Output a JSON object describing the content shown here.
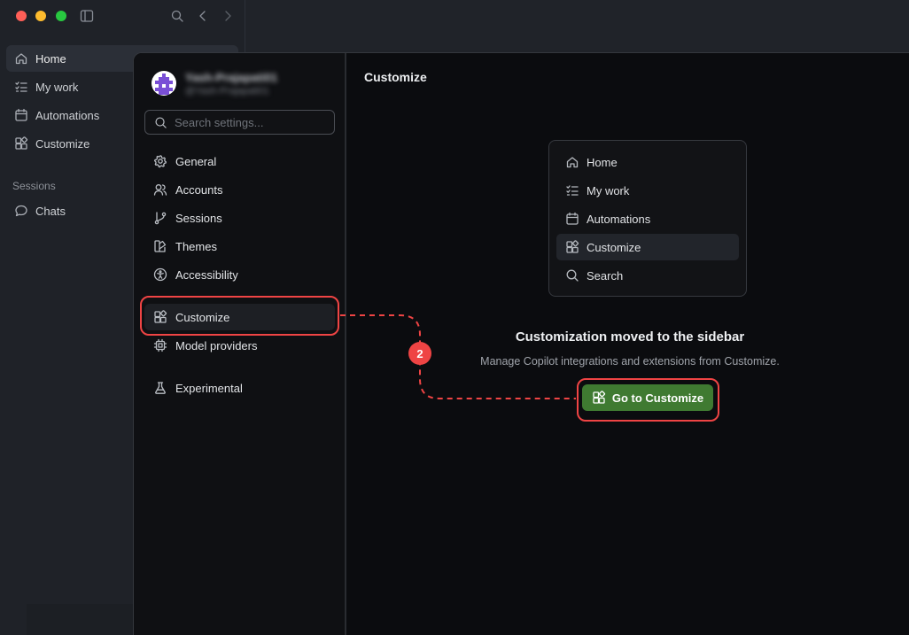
{
  "app": {
    "sidebar": {
      "items": [
        {
          "label": "Home",
          "icon": "home-icon"
        },
        {
          "label": "My work",
          "icon": "checklist-icon"
        },
        {
          "label": "Automations",
          "icon": "calendar-icon"
        },
        {
          "label": "Customize",
          "icon": "blocks-icon"
        }
      ],
      "sessions_label": "Sessions",
      "session_items": [
        {
          "label": "Chats",
          "icon": "chat-bubble-icon"
        }
      ]
    }
  },
  "settings": {
    "user": {
      "name": "Yash-Prajapati01",
      "handle": "@Yash-Prajapati01"
    },
    "search": {
      "placeholder": "Search settings..."
    },
    "nav": [
      {
        "label": "General",
        "icon": "gear-icon"
      },
      {
        "label": "Accounts",
        "icon": "people-icon"
      },
      {
        "label": "Sessions",
        "icon": "git-branch-icon"
      },
      {
        "label": "Themes",
        "icon": "paint-icon"
      },
      {
        "label": "Accessibility",
        "icon": "accessibility-icon"
      },
      {
        "label": "Customize",
        "icon": "blocks-icon",
        "active": true
      },
      {
        "label": "Model providers",
        "icon": "cpu-icon"
      },
      {
        "label": "Experimental",
        "icon": "flask-icon"
      }
    ]
  },
  "content": {
    "title": "Customize",
    "preview": [
      {
        "label": "Home",
        "icon": "home-icon"
      },
      {
        "label": "My work",
        "icon": "checklist-icon"
      },
      {
        "label": "Automations",
        "icon": "calendar-icon"
      },
      {
        "label": "Customize",
        "icon": "blocks-icon",
        "active": true
      },
      {
        "label": "Search",
        "icon": "search-icon"
      }
    ],
    "moved_title": "Customization moved to the sidebar",
    "moved_description": "Manage Copilot integrations and extensions from Customize.",
    "button_label": "Go to Customize"
  },
  "annotation": {
    "step": "2",
    "color": "#ef4444"
  },
  "colors": {
    "accent_button": "#3f7a31",
    "highlight": "#ef4444"
  }
}
